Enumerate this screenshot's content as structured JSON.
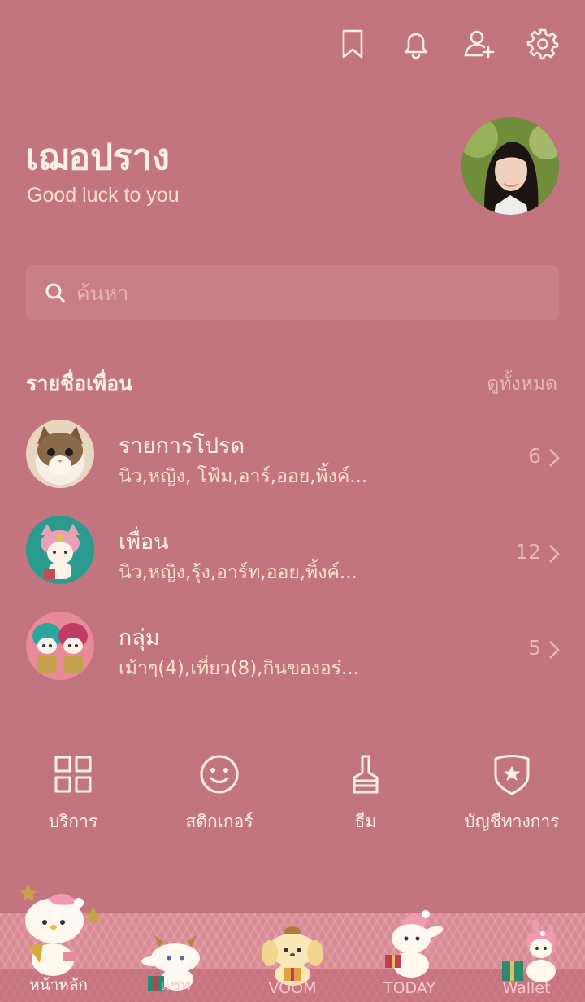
{
  "header": {
    "icons": [
      "bookmark-icon",
      "bell-icon",
      "add-friend-icon",
      "settings-icon"
    ]
  },
  "profile": {
    "name": "เฌอปราง",
    "status": "Good luck to you"
  },
  "search": {
    "placeholder": "ค้นหา"
  },
  "friends_section": {
    "title": "รายชื่อเพื่อน",
    "see_all": "ดูทั้งหมด",
    "rows": [
      {
        "title": "รายการโปรด",
        "subtitle": "นิว,หญิง, โฟ้ม,อาร์,ออย,พิ้งค์...",
        "count": "6"
      },
      {
        "title": "เพื่อน",
        "subtitle": "นิว,หญิง,รุ้ง,อาร์ท,ออย,พิ้งค์...",
        "count": "12"
      },
      {
        "title": "กลุ่ม",
        "subtitle": "เม้าๆ(4),เที่ยว(8),กินของอร่...",
        "count": "5"
      }
    ]
  },
  "shortcuts": [
    {
      "label": "บริการ",
      "icon": "grid-icon"
    },
    {
      "label": "สติกเกอร์",
      "icon": "smiley-icon"
    },
    {
      "label": "ธีม",
      "icon": "brush-icon"
    },
    {
      "label": "บัญชีทางการ",
      "icon": "shield-star-icon"
    }
  ],
  "bottom_nav": {
    "active": "หน้าหลัก",
    "tabs": [
      {
        "label": "หน้าหลัก",
        "icon": "home-character-icon"
      },
      {
        "label": "แชท",
        "icon": "chat-character-icon"
      },
      {
        "label": "VOOM",
        "icon": "voom-character-icon"
      },
      {
        "label": "TODAY",
        "icon": "today-character-icon"
      },
      {
        "label": "Wallet",
        "icon": "wallet-character-icon"
      }
    ]
  },
  "colors": {
    "background": "#c2757f",
    "text": "#fdf1e6",
    "muted": "#e8b5b9",
    "search_bg": "#c97f88",
    "tabbar_bg": "#d98a94"
  }
}
